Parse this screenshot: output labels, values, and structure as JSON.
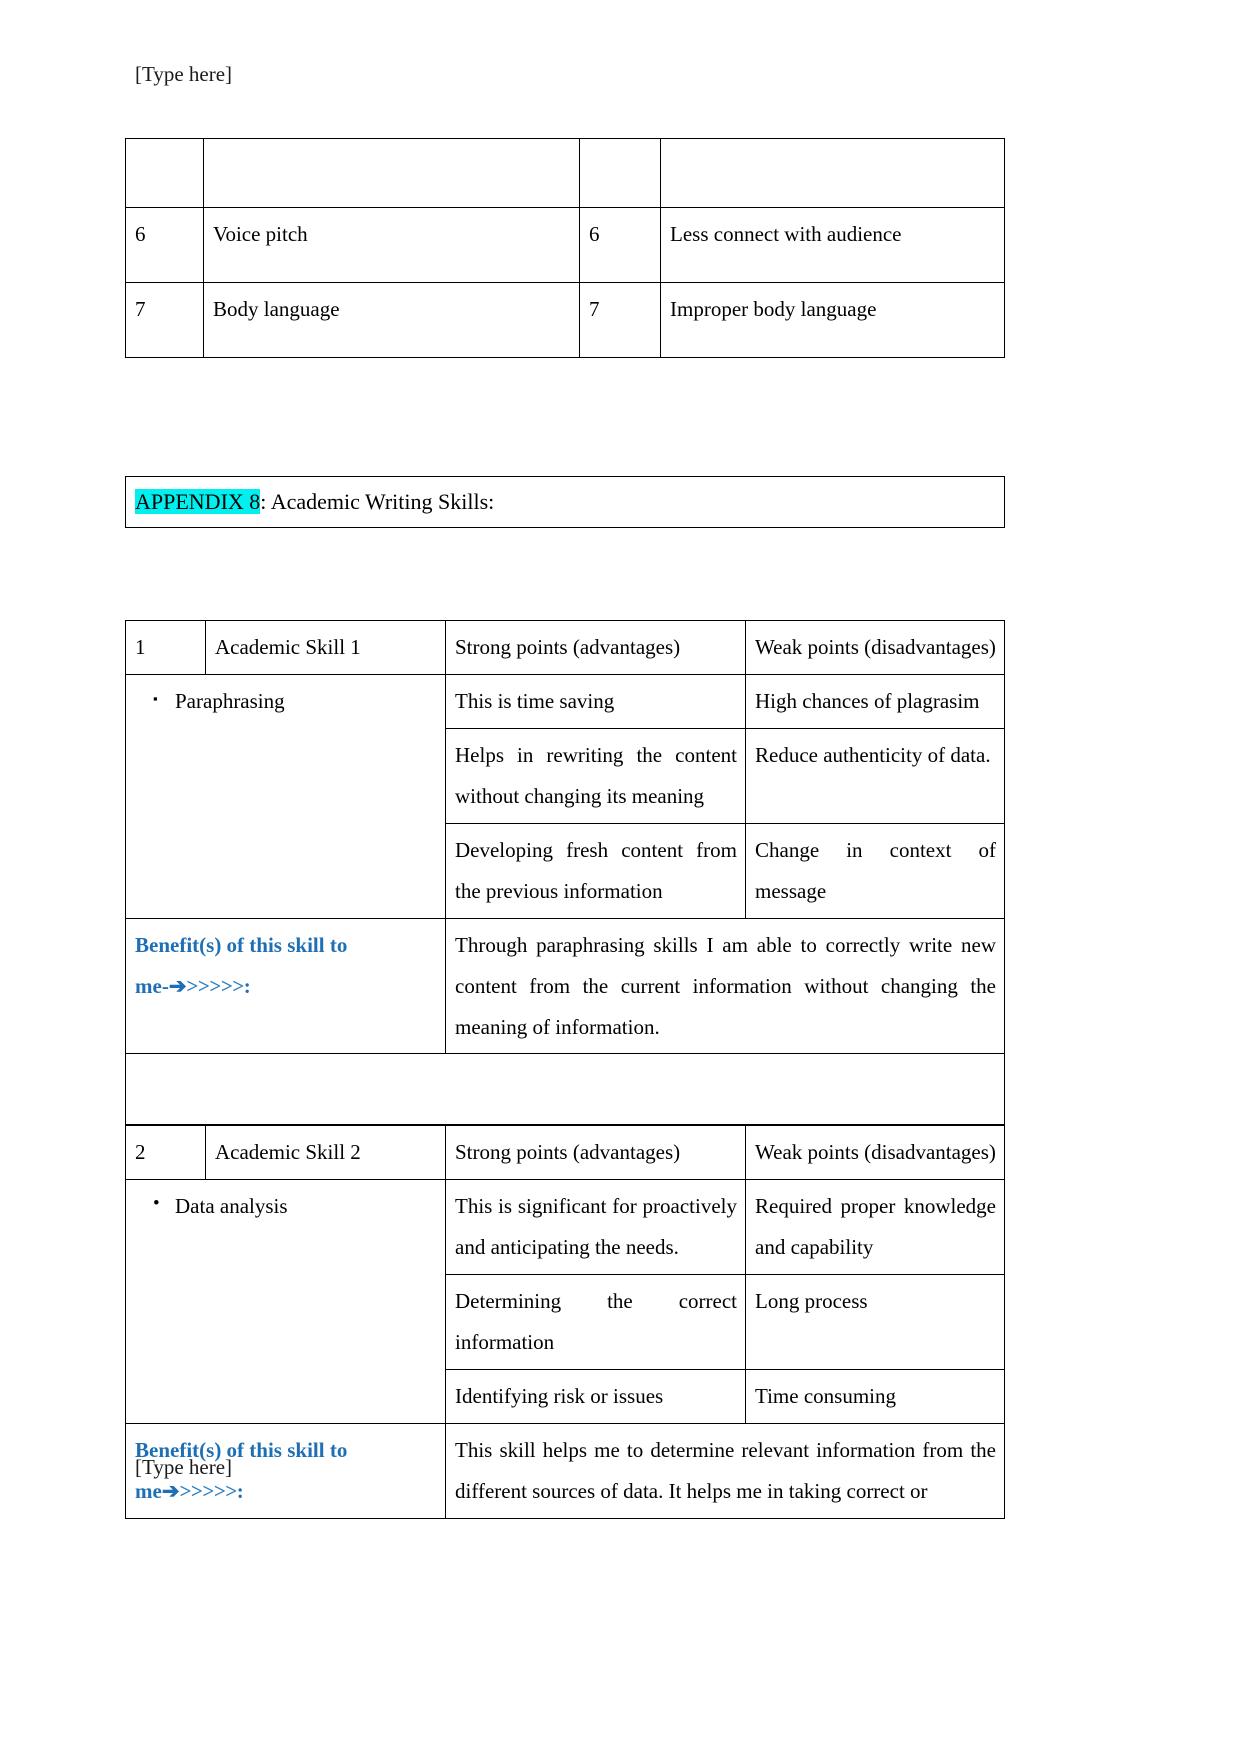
{
  "page": {
    "header_note": "[Type here]",
    "footer_note": "[Type here]"
  },
  "top_table": {
    "rows": [
      {
        "num": "",
        "skill": "",
        "num2": "",
        "issue": ""
      },
      {
        "num": "6",
        "skill": "Voice pitch",
        "num2": "6",
        "issue": "Less connect with audience"
      },
      {
        "num": "7",
        "skill": "Body language",
        "num2": "7",
        "issue": "Improper body language"
      }
    ]
  },
  "appendix": {
    "highlight": "APPENDIX 8",
    "rest": ": Academic Writing Skills:",
    "highlight_color": "#00F0F0"
  },
  "skill_tables": [
    {
      "index": "1",
      "title": "Academic Skill 1",
      "adv_header": "Strong points (advantages)",
      "dis_header": "Weak points (disadvantages)",
      "bullet_glyph": "▪",
      "skill_name": "Paraphrasing",
      "pairs": [
        {
          "adv": "This is time saving",
          "dis": "High chances of plagrasim"
        },
        {
          "adv": "Helps in rewriting the content without changing its meaning",
          "dis": "Reduce authenticity of data."
        },
        {
          "adv": "Developing fresh content from the previous information",
          "dis": "Change in context of message"
        }
      ],
      "benefit_label_line1": "Benefit(s) of this skill to",
      "benefit_label_line2_pre": "me-",
      "benefit_label_arrow": "➔",
      "benefit_label_chevrons": ">>>>>",
      "benefit_label_end": ":",
      "benefit_text": "Through paraphrasing skills I am able to correctly write new content from the current information without changing the meaning of information."
    },
    {
      "index": "2",
      "title": "Academic Skill 2",
      "adv_header": "Strong points (advantages)",
      "dis_header": "Weak points (disadvantages)",
      "bullet_glyph": "•",
      "skill_name": "Data analysis",
      "pairs": [
        {
          "adv": "This is significant for proactively and anticipating the needs.",
          "dis": "Required proper knowledge and capability"
        },
        {
          "adv": "Determining the correct information",
          "dis": "Long process"
        },
        {
          "adv": "Identifying risk or issues",
          "dis": "Time consuming"
        }
      ],
      "benefit_label_line1": "Benefit(s) of this skill to",
      "benefit_label_line2_pre": "me",
      "benefit_label_arrow": "➔",
      "benefit_label_chevrons": ">>>>>",
      "benefit_label_end": ":",
      "benefit_text": "This skill helps me to determine relevant information from the different sources of data. It  helps me in taking correct or"
    }
  ],
  "colors": {
    "benefit_blue": "#1F6FB5",
    "highlight_cyan": "#00F0F0",
    "border": "#000000"
  }
}
